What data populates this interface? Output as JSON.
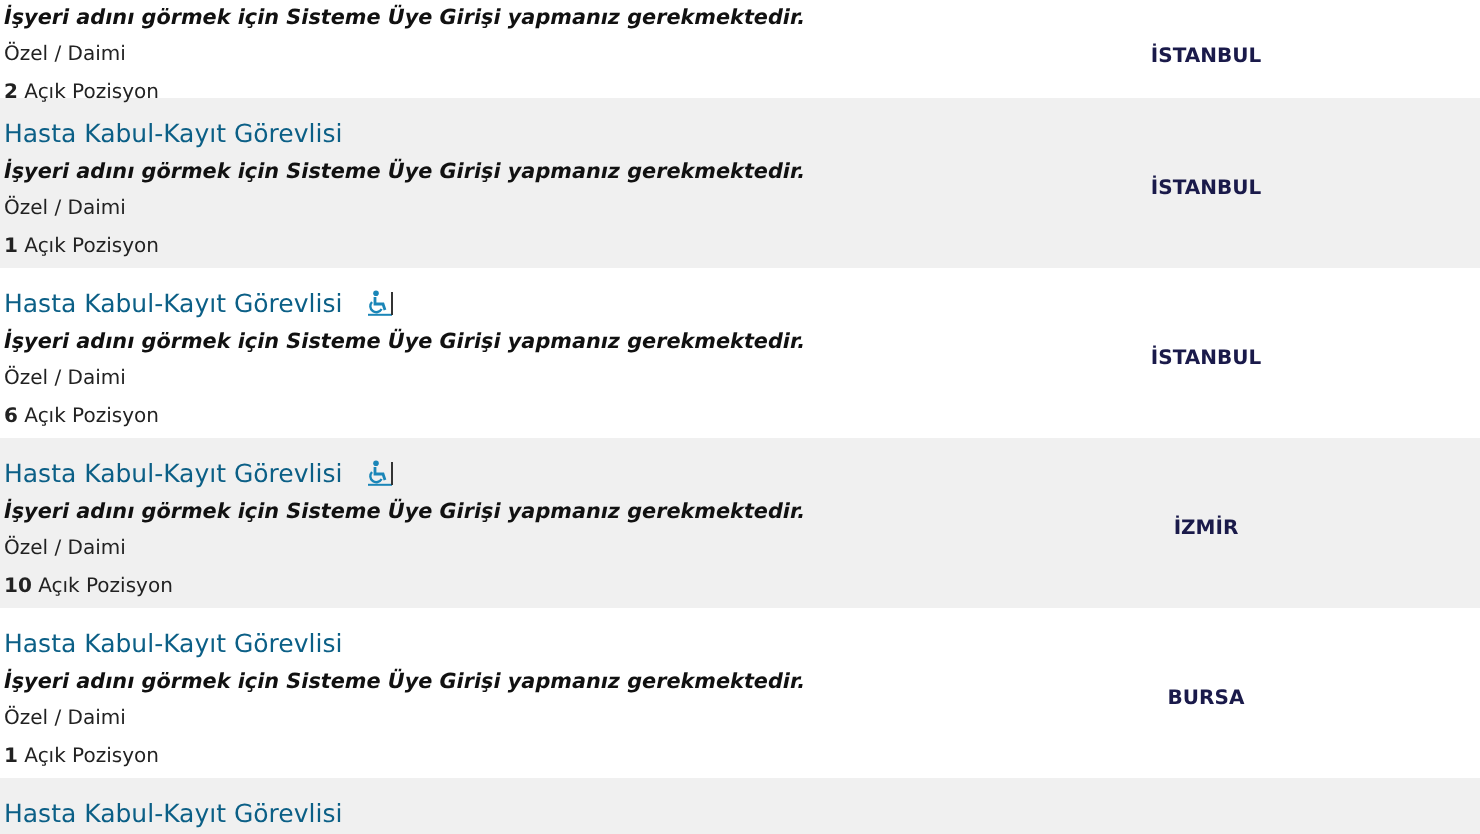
{
  "listings": [
    {
      "accessible": false,
      "notice": "İşyeri adını görmek için Sisteme Üye Girişi yapmanız gerekmektedir.",
      "type": "Özel / Daimi",
      "positions": "**2** Açık Pozisyon",
      "city": "İSTANBUL"
    },
    {
      "title": "Hasta Kabul-Kayıt Görevlisi",
      "accessible": false,
      "notice": "İşyeri adını görmek için Sisteme Üye Girişi yapmanız gerekmektedir.",
      "type": "Özel / Daimi",
      "positions": "**1** Açık Pozisyon",
      "city": "İSTANBUL"
    },
    {
      "title": "Hasta Kabul-Kayıt Görevlisi",
      "accessible": true,
      "notice": "İşyeri adını görmek için Sisteme Üye Girişi yapmanız gerekmektedir.",
      "type": "Özel / Daimi",
      "positions": "**6** Açık Pozisyon",
      "city": "İSTANBUL"
    },
    {
      "title": "Hasta Kabul-Kayıt Görevlisi",
      "accessible": true,
      "notice": "İşyeri adını görmek için Sisteme Üye Girişi yapmanız gerekmektedir.",
      "type": "Özel / Daimi",
      "positions": "**10** Açık Pozisyon",
      "city": "İZMİR"
    },
    {
      "title": "Hasta Kabul-Kayıt Görevlisi",
      "accessible": false,
      "notice": "İşyeri adını görmek için Sisteme Üye Girişi yapmanız gerekmektedir.",
      "type": "Özel / Daimi",
      "positions": "**1** Açık Pozisyon",
      "city": "BURSA"
    },
    {
      "title": "Hasta Kabul-Kayıt Görevlisi",
      "accessible": false
    }
  ]
}
